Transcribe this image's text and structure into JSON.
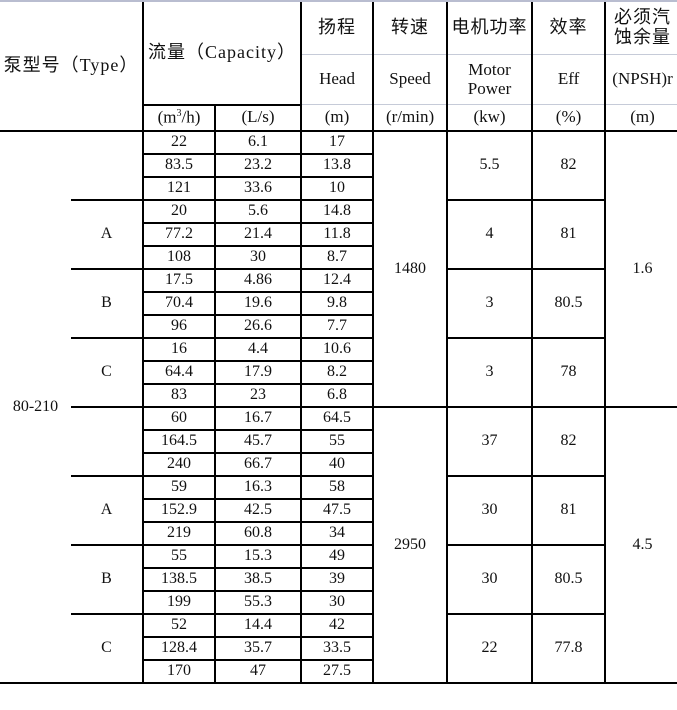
{
  "header": {
    "type_label": "泵型号（Type）",
    "capacity_label": "流量（Capacity）",
    "capacity_unit_m3h_prefix": "(m",
    "capacity_unit_m3h_sup": "3",
    "capacity_unit_m3h_suffix": "/h)",
    "capacity_unit_ls": "(L/s)",
    "head_zh": "扬程",
    "head_en": "Head",
    "head_unit": "(m)",
    "speed_zh": "转速",
    "speed_en": "Speed",
    "speed_unit": "(r/min)",
    "power_zh": "电机功率",
    "power_en_line1": "Motor",
    "power_en_line2": "Power",
    "power_unit": "(kw)",
    "eff_zh": "效率",
    "eff_en": "Eff",
    "eff_unit": "(%)",
    "npsh_zh_line1": "必须汽",
    "npsh_zh_line2": "蚀余量",
    "npsh_en": "(NPSH)r",
    "npsh_unit": "(m)"
  },
  "model": "80-210",
  "speed_groups": [
    {
      "speed": "1480",
      "npsh": "1.6"
    },
    {
      "speed": "2950",
      "npsh": "4.5"
    }
  ],
  "variants": [
    {
      "type": "",
      "power": "5.5",
      "eff": "82",
      "rows": [
        {
          "m3h": "22",
          "ls": "6.1",
          "head": "17"
        },
        {
          "m3h": "83.5",
          "ls": "23.2",
          "head": "13.8"
        },
        {
          "m3h": "121",
          "ls": "33.6",
          "head": "10"
        }
      ]
    },
    {
      "type": "A",
      "power": "4",
      "eff": "81",
      "rows": [
        {
          "m3h": "20",
          "ls": "5.6",
          "head": "14.8"
        },
        {
          "m3h": "77.2",
          "ls": "21.4",
          "head": "11.8"
        },
        {
          "m3h": "108",
          "ls": "30",
          "head": "8.7"
        }
      ]
    },
    {
      "type": "B",
      "power": "3",
      "eff": "80.5",
      "rows": [
        {
          "m3h": "17.5",
          "ls": "4.86",
          "head": "12.4"
        },
        {
          "m3h": "70.4",
          "ls": "19.6",
          "head": "9.8"
        },
        {
          "m3h": "96",
          "ls": "26.6",
          "head": "7.7"
        }
      ]
    },
    {
      "type": "C",
      "power": "3",
      "eff": "78",
      "rows": [
        {
          "m3h": "16",
          "ls": "4.4",
          "head": "10.6"
        },
        {
          "m3h": "64.4",
          "ls": "17.9",
          "head": "8.2"
        },
        {
          "m3h": "83",
          "ls": "23",
          "head": "6.8"
        }
      ]
    },
    {
      "type": "",
      "power": "37",
      "eff": "82",
      "rows": [
        {
          "m3h": "60",
          "ls": "16.7",
          "head": "64.5"
        },
        {
          "m3h": "164.5",
          "ls": "45.7",
          "head": "55"
        },
        {
          "m3h": "240",
          "ls": "66.7",
          "head": "40"
        }
      ]
    },
    {
      "type": "A",
      "power": "30",
      "eff": "81",
      "rows": [
        {
          "m3h": "59",
          "ls": "16.3",
          "head": "58"
        },
        {
          "m3h": "152.9",
          "ls": "42.5",
          "head": "47.5"
        },
        {
          "m3h": "219",
          "ls": "60.8",
          "head": "34"
        }
      ]
    },
    {
      "type": "B",
      "power": "30",
      "eff": "80.5",
      "rows": [
        {
          "m3h": "55",
          "ls": "15.3",
          "head": "49"
        },
        {
          "m3h": "138.5",
          "ls": "38.5",
          "head": "39"
        },
        {
          "m3h": "199",
          "ls": "55.3",
          "head": "30"
        }
      ]
    },
    {
      "type": "C",
      "power": "22",
      "eff": "77.8",
      "rows": [
        {
          "m3h": "52",
          "ls": "14.4",
          "head": "42"
        },
        {
          "m3h": "128.4",
          "ls": "35.7",
          "head": "33.5"
        },
        {
          "m3h": "170",
          "ls": "47",
          "head": "27.5"
        }
      ]
    }
  ]
}
